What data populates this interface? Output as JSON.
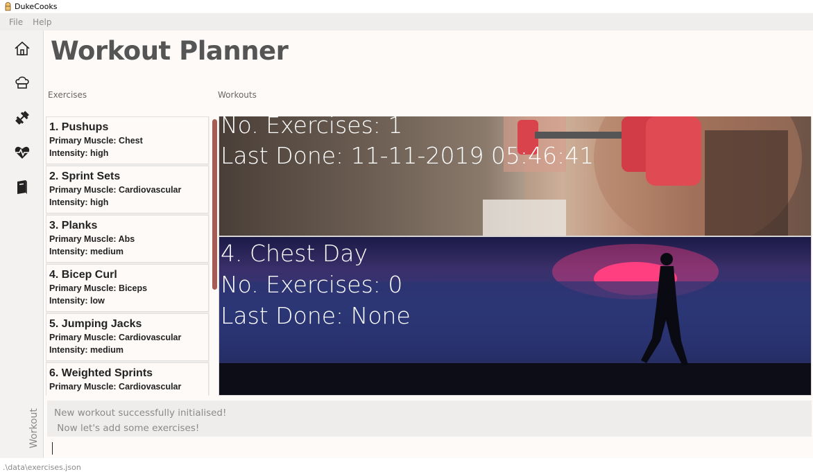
{
  "window": {
    "title": "DukeCooks"
  },
  "menu": {
    "file": "File",
    "help": "Help"
  },
  "sidebar": {
    "items": [
      {
        "icon": "home-icon"
      },
      {
        "icon": "chef-hat-icon"
      },
      {
        "icon": "dumbbell-icon"
      },
      {
        "icon": "heartbeat-icon"
      },
      {
        "icon": "diary-icon"
      }
    ],
    "current_label": "Workout"
  },
  "page": {
    "title": "Workout Planner"
  },
  "columns": {
    "exercises": "Exercises",
    "workouts": "Workouts"
  },
  "exercises": [
    {
      "name": "1.  Pushups",
      "muscle": "Primary Muscle: Chest",
      "intensity": "Intensity: high"
    },
    {
      "name": "2.  Sprint Sets",
      "muscle": "Primary Muscle: Cardiovascular",
      "intensity": "Intensity: high"
    },
    {
      "name": "3.  Planks",
      "muscle": "Primary Muscle: Abs",
      "intensity": "Intensity: medium"
    },
    {
      "name": "4.  Bicep Curl",
      "muscle": "Primary Muscle: Biceps",
      "intensity": "Intensity: low"
    },
    {
      "name": "5.  Jumping Jacks",
      "muscle": "Primary Muscle: Cardiovascular",
      "intensity": "Intensity: medium"
    },
    {
      "name": "6.  Weighted Sprints",
      "muscle": "Primary Muscle: Cardiovascular",
      "intensity": ""
    }
  ],
  "workouts": [
    {
      "lines": [
        "No. Exercises: 1",
        "Last Done: 11-11-2019 05:46:41"
      ]
    },
    {
      "lines": [
        "4. Chest Day",
        "No. Exercises: 0",
        "Last Done: None"
      ]
    }
  ],
  "output": {
    "line1": "New workout successfully initialised!",
    "line2": " Now let's add some exercises!"
  },
  "command": {
    "value": ""
  },
  "status": {
    "path": ".\\data\\exercises.json"
  },
  "colors": {
    "scroll_thumb": "#a85a55",
    "sun": "#ff3f7f"
  }
}
